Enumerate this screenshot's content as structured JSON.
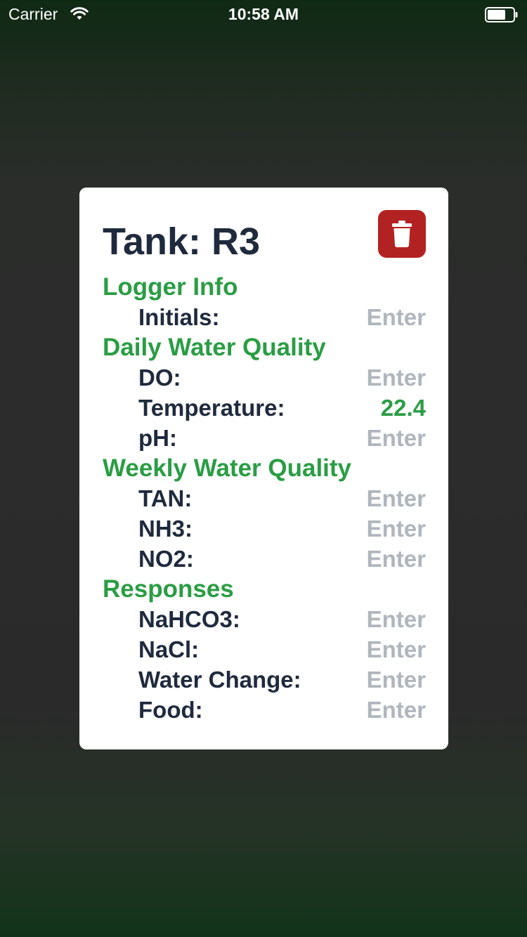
{
  "status_bar": {
    "carrier": "Carrier",
    "time": "10:58 AM",
    "icons": [
      "wifi-icon",
      "battery-icon"
    ]
  },
  "card": {
    "title": "Tank: R3",
    "delete_icon": "trash-icon",
    "colors": {
      "delete_button": "#b32222",
      "section_heading": "#2a9d44",
      "label": "#1f2a3d",
      "placeholder": "#b0b6bd",
      "filled_value": "#2a9d44"
    },
    "sections": {
      "logger_info": {
        "heading": "Logger Info",
        "initials": {
          "label": "Initials:",
          "value": "Enter"
        }
      },
      "daily": {
        "heading": "Daily Water Quality",
        "do": {
          "label": "DO:",
          "value": "Enter"
        },
        "temperature": {
          "label": "Temperature:",
          "value": "22.4"
        },
        "ph": {
          "label": "pH:",
          "value": "Enter"
        }
      },
      "weekly": {
        "heading": "Weekly Water Quality",
        "tan": {
          "label": "TAN:",
          "value": "Enter"
        },
        "nh3": {
          "label": "NH3:",
          "value": "Enter"
        },
        "no2": {
          "label": "NO2:",
          "value": "Enter"
        }
      },
      "responses": {
        "heading": "Responses",
        "nahco3": {
          "label": "NaHCO3:",
          "value": "Enter"
        },
        "nacl": {
          "label": "NaCl:",
          "value": "Enter"
        },
        "water_change": {
          "label": "Water Change:",
          "value": "Enter"
        },
        "food": {
          "label": "Food:",
          "value": "Enter"
        }
      }
    }
  }
}
